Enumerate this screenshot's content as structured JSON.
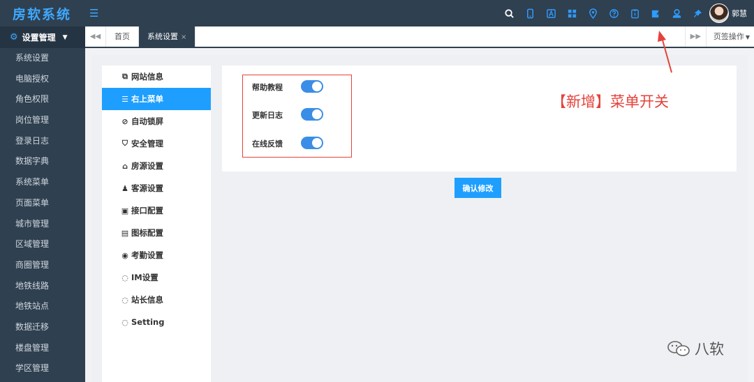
{
  "header": {
    "title": "房软系统",
    "menu_toggle": "☰",
    "icons": [
      "search-icon",
      "mobile-icon",
      "font-icon",
      "grid-icon",
      "location-icon",
      "help-icon",
      "clipboard-icon",
      "edit-icon",
      "user-icon",
      "pin-icon"
    ],
    "user_name": "郭慧"
  },
  "sidebar": {
    "section_title": "设置管理",
    "items": [
      "系统设置",
      "电脑授权",
      "角色权限",
      "岗位管理",
      "登录日志",
      "数据字典",
      "系统菜单",
      "页面菜单",
      "城市管理",
      "区域管理",
      "商圈管理",
      "地铁线路",
      "地铁站点",
      "数据迁移",
      "楼盘管理",
      "学区管理"
    ]
  },
  "tabs": {
    "items": [
      {
        "label": "首页",
        "active": false
      },
      {
        "label": "系统设置",
        "active": true,
        "close": "×"
      }
    ],
    "operations": "页签操作"
  },
  "settings_menu": {
    "items": [
      {
        "label": "网站信息",
        "icon": "site-icon",
        "glyph": "⧉",
        "active": false
      },
      {
        "label": "右上菜单",
        "icon": "list-icon",
        "glyph": "☰",
        "active": true
      },
      {
        "label": "自动锁屏",
        "icon": "ban-icon",
        "glyph": "⊘",
        "active": false
      },
      {
        "label": "安全管理",
        "icon": "shield-icon",
        "glyph": "⛉",
        "active": false
      },
      {
        "label": "房源设置",
        "icon": "home-icon",
        "glyph": "⌂",
        "active": false
      },
      {
        "label": "客源设置",
        "icon": "person-icon",
        "glyph": "♟",
        "active": false
      },
      {
        "label": "接口配置",
        "icon": "image-icon",
        "glyph": "▣",
        "active": false
      },
      {
        "label": "图标配置",
        "icon": "image-plus-icon",
        "glyph": "▤",
        "active": false
      },
      {
        "label": "考勤设置",
        "icon": "location-icon",
        "glyph": "◉",
        "active": false
      },
      {
        "label": "IM设置",
        "icon": "chat-icon",
        "glyph": "◌",
        "active": false
      },
      {
        "label": "站长信息",
        "icon": "chat-icon",
        "glyph": "◌",
        "active": false
      },
      {
        "label": "Setting",
        "icon": "chat-icon",
        "glyph": "◌",
        "active": false
      }
    ]
  },
  "toggles": [
    {
      "label": "帮助教程",
      "on": true
    },
    {
      "label": "更新日志",
      "on": true
    },
    {
      "label": "在线反馈",
      "on": true
    }
  ],
  "annotation": "【新增】菜单开关",
  "confirm_button": "确认修改",
  "watermark": "八软",
  "colors": {
    "header_bg": "#2f4050",
    "accent": "#1e9fff",
    "annotation": "#e5423b"
  }
}
